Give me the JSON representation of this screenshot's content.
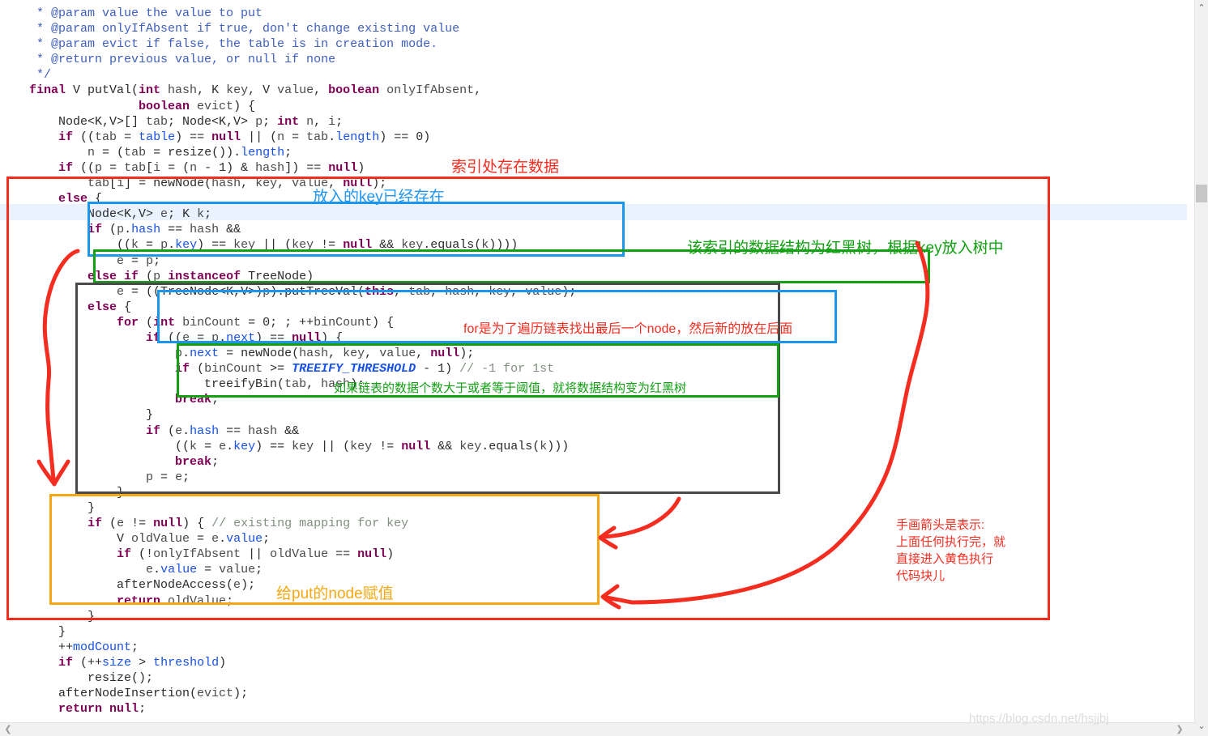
{
  "editor": {
    "language": "java",
    "caret_line_index": 13,
    "code_lines": [
      [
        [
          "doc",
          "     * @param value the value to put"
        ]
      ],
      [
        [
          "doc",
          "     * @param onlyIfAbsent if true, don't change existing value"
        ]
      ],
      [
        [
          "doc",
          "     * @param evict if false, the table is in creation mode."
        ]
      ],
      [
        [
          "doc",
          "     * @return previous value, or null if none"
        ]
      ],
      [
        [
          "doc",
          "     */"
        ]
      ],
      [
        [
          "kw",
          "    final"
        ],
        [
          "pln",
          " V putVal("
        ],
        [
          "kw",
          "int"
        ],
        [
          "idf",
          " hash"
        ],
        [
          "pln",
          ", K "
        ],
        [
          "idf",
          "key"
        ],
        [
          "pln",
          ", V "
        ],
        [
          "idf",
          "value"
        ],
        [
          "pln",
          ", "
        ],
        [
          "kw",
          "boolean"
        ],
        [
          "idf",
          " onlyIfAbsent"
        ],
        [
          "pln",
          ","
        ]
      ],
      [
        [
          "pln",
          "                   "
        ],
        [
          "kw",
          "boolean"
        ],
        [
          "idf",
          " evict"
        ],
        [
          "pln",
          ") {"
        ]
      ],
      [
        [
          "pln",
          "        Node<K,V>[] "
        ],
        [
          "idf",
          "tab"
        ],
        [
          "pln",
          "; Node<K,V> "
        ],
        [
          "idf",
          "p"
        ],
        [
          "pln",
          "; "
        ],
        [
          "kw",
          "int"
        ],
        [
          "idf",
          " n"
        ],
        [
          "pln",
          ", "
        ],
        [
          "idf",
          "i"
        ],
        [
          "pln",
          ";"
        ]
      ],
      [
        [
          "pln",
          "        "
        ],
        [
          "kw",
          "if"
        ],
        [
          "pln",
          " (("
        ],
        [
          "idf",
          "tab"
        ],
        [
          "pln",
          " = "
        ],
        [
          "fld",
          "table"
        ],
        [
          "pln",
          ") == "
        ],
        [
          "kw",
          "null"
        ],
        [
          "pln",
          " || ("
        ],
        [
          "idf",
          "n"
        ],
        [
          "pln",
          " = "
        ],
        [
          "idf",
          "tab"
        ],
        [
          "pln",
          "."
        ],
        [
          "fld",
          "length"
        ],
        [
          "pln",
          ") == 0)"
        ]
      ],
      [
        [
          "pln",
          "            "
        ],
        [
          "idf",
          "n"
        ],
        [
          "pln",
          " = ("
        ],
        [
          "idf",
          "tab"
        ],
        [
          "pln",
          " = resize())."
        ],
        [
          "fld",
          "length"
        ],
        [
          "pln",
          ";"
        ]
      ],
      [
        [
          "pln",
          "        "
        ],
        [
          "kw",
          "if"
        ],
        [
          "pln",
          " (("
        ],
        [
          "idf",
          "p"
        ],
        [
          "pln",
          " = "
        ],
        [
          "idf",
          "tab"
        ],
        [
          "pln",
          "["
        ],
        [
          "idf",
          "i"
        ],
        [
          "pln",
          " = ("
        ],
        [
          "idf",
          "n"
        ],
        [
          "pln",
          " - 1) & "
        ],
        [
          "idf",
          "hash"
        ],
        [
          "pln",
          "]) == "
        ],
        [
          "kw",
          "null"
        ],
        [
          "pln",
          ")"
        ]
      ],
      [
        [
          "pln",
          "            "
        ],
        [
          "idf",
          "tab"
        ],
        [
          "pln",
          "["
        ],
        [
          "idf",
          "i"
        ],
        [
          "pln",
          "] = newNode("
        ],
        [
          "idf",
          "hash"
        ],
        [
          "pln",
          ", "
        ],
        [
          "idf",
          "key"
        ],
        [
          "pln",
          ", "
        ],
        [
          "idf",
          "value"
        ],
        [
          "pln",
          ", "
        ],
        [
          "kw",
          "null"
        ],
        [
          "pln",
          ");"
        ]
      ],
      [
        [
          "pln",
          "        "
        ],
        [
          "kw",
          "else"
        ],
        [
          "pln",
          " {"
        ]
      ],
      [
        [
          "pln",
          "            Node<K,V> "
        ],
        [
          "idf",
          "e"
        ],
        [
          "pln",
          "; K "
        ],
        [
          "idf",
          "k"
        ],
        [
          "pln",
          ";"
        ]
      ],
      [
        [
          "pln",
          "            "
        ],
        [
          "kw",
          "if"
        ],
        [
          "pln",
          " ("
        ],
        [
          "idf",
          "p"
        ],
        [
          "pln",
          "."
        ],
        [
          "fld",
          "hash"
        ],
        [
          "pln",
          " == "
        ],
        [
          "idf",
          "hash"
        ],
        [
          "pln",
          " &&"
        ]
      ],
      [
        [
          "pln",
          "                (("
        ],
        [
          "idf",
          "k"
        ],
        [
          "pln",
          " = "
        ],
        [
          "idf",
          "p"
        ],
        [
          "pln",
          "."
        ],
        [
          "fld",
          "key"
        ],
        [
          "pln",
          ") == "
        ],
        [
          "idf",
          "key"
        ],
        [
          "pln",
          " || ("
        ],
        [
          "idf",
          "key"
        ],
        [
          "pln",
          " != "
        ],
        [
          "kw",
          "null"
        ],
        [
          "pln",
          " && "
        ],
        [
          "idf",
          "key"
        ],
        [
          "pln",
          ".equals("
        ],
        [
          "idf",
          "k"
        ],
        [
          "pln",
          "))))"
        ]
      ],
      [
        [
          "pln",
          "                "
        ],
        [
          "idf",
          "e"
        ],
        [
          "pln",
          " = "
        ],
        [
          "idf",
          "p"
        ],
        [
          "pln",
          ";"
        ]
      ],
      [
        [
          "pln",
          "            "
        ],
        [
          "kw",
          "else if"
        ],
        [
          "pln",
          " ("
        ],
        [
          "idf",
          "p"
        ],
        [
          "pln",
          " "
        ],
        [
          "kw",
          "instanceof"
        ],
        [
          "pln",
          " TreeNode)"
        ]
      ],
      [
        [
          "pln",
          "                "
        ],
        [
          "idf",
          "e"
        ],
        [
          "pln",
          " = ((TreeNode<K,V>)"
        ],
        [
          "idf",
          "p"
        ],
        [
          "pln",
          ").putTreeVal("
        ],
        [
          "kw",
          "this"
        ],
        [
          "pln",
          ", "
        ],
        [
          "idf",
          "tab"
        ],
        [
          "pln",
          ", "
        ],
        [
          "idf",
          "hash"
        ],
        [
          "pln",
          ", "
        ],
        [
          "idf",
          "key"
        ],
        [
          "pln",
          ", "
        ],
        [
          "idf",
          "value"
        ],
        [
          "pln",
          ");"
        ]
      ],
      [
        [
          "pln",
          "            "
        ],
        [
          "kw",
          "else"
        ],
        [
          "pln",
          " {"
        ]
      ],
      [
        [
          "pln",
          "                "
        ],
        [
          "kw",
          "for"
        ],
        [
          "pln",
          " ("
        ],
        [
          "kw",
          "int"
        ],
        [
          "idf",
          " binCount"
        ],
        [
          "pln",
          " = 0; ; ++"
        ],
        [
          "idf",
          "binCount"
        ],
        [
          "pln",
          ") {"
        ]
      ],
      [
        [
          "pln",
          "                    "
        ],
        [
          "kw",
          "if"
        ],
        [
          "pln",
          " (("
        ],
        [
          "idf",
          "e"
        ],
        [
          "pln",
          " = "
        ],
        [
          "idf",
          "p"
        ],
        [
          "pln",
          "."
        ],
        [
          "fld",
          "next"
        ],
        [
          "pln",
          ") == "
        ],
        [
          "kw",
          "null"
        ],
        [
          "pln",
          ") {"
        ]
      ],
      [
        [
          "pln",
          "                        "
        ],
        [
          "idf",
          "p"
        ],
        [
          "pln",
          "."
        ],
        [
          "fld",
          "next"
        ],
        [
          "pln",
          " = newNode("
        ],
        [
          "idf",
          "hash"
        ],
        [
          "pln",
          ", "
        ],
        [
          "idf",
          "key"
        ],
        [
          "pln",
          ", "
        ],
        [
          "idf",
          "value"
        ],
        [
          "pln",
          ", "
        ],
        [
          "kw",
          "null"
        ],
        [
          "pln",
          ");"
        ]
      ],
      [
        [
          "pln",
          "                        "
        ],
        [
          "kw",
          "if"
        ],
        [
          "pln",
          " ("
        ],
        [
          "idf",
          "binCount"
        ],
        [
          "pln",
          " >= "
        ],
        [
          "sfld",
          "TREEIFY_THRESHOLD"
        ],
        [
          "pln",
          " - 1) "
        ],
        [
          "cmt",
          "// -1 for 1st"
        ]
      ],
      [
        [
          "pln",
          "                            treeifyBin("
        ],
        [
          "idf",
          "tab"
        ],
        [
          "pln",
          ", "
        ],
        [
          "idf",
          "hash"
        ],
        [
          "pln",
          ");"
        ]
      ],
      [
        [
          "pln",
          "                        "
        ],
        [
          "kw",
          "break"
        ],
        [
          "pln",
          ";"
        ]
      ],
      [
        [
          "pln",
          "                    }"
        ]
      ],
      [
        [
          "pln",
          "                    "
        ],
        [
          "kw",
          "if"
        ],
        [
          "pln",
          " ("
        ],
        [
          "idf",
          "e"
        ],
        [
          "pln",
          "."
        ],
        [
          "fld",
          "hash"
        ],
        [
          "pln",
          " == "
        ],
        [
          "idf",
          "hash"
        ],
        [
          "pln",
          " &&"
        ]
      ],
      [
        [
          "pln",
          "                        (("
        ],
        [
          "idf",
          "k"
        ],
        [
          "pln",
          " = "
        ],
        [
          "idf",
          "e"
        ],
        [
          "pln",
          "."
        ],
        [
          "fld",
          "key"
        ],
        [
          "pln",
          ") == "
        ],
        [
          "idf",
          "key"
        ],
        [
          "pln",
          " || ("
        ],
        [
          "idf",
          "key"
        ],
        [
          "pln",
          " != "
        ],
        [
          "kw",
          "null"
        ],
        [
          "pln",
          " && "
        ],
        [
          "idf",
          "key"
        ],
        [
          "pln",
          ".equals("
        ],
        [
          "idf",
          "k"
        ],
        [
          "pln",
          ")))"
        ]
      ],
      [
        [
          "pln",
          "                        "
        ],
        [
          "kw",
          "break"
        ],
        [
          "pln",
          ";"
        ]
      ],
      [
        [
          "pln",
          "                    "
        ],
        [
          "idf",
          "p"
        ],
        [
          "pln",
          " = "
        ],
        [
          "idf",
          "e"
        ],
        [
          "pln",
          ";"
        ]
      ],
      [
        [
          "pln",
          "                }"
        ]
      ],
      [
        [
          "pln",
          "            }"
        ]
      ],
      [
        [
          "pln",
          "            "
        ],
        [
          "kw",
          "if"
        ],
        [
          "pln",
          " ("
        ],
        [
          "idf",
          "e"
        ],
        [
          "pln",
          " != "
        ],
        [
          "kw",
          "null"
        ],
        [
          "pln",
          ") { "
        ],
        [
          "cmt",
          "// existing mapping for key"
        ]
      ],
      [
        [
          "pln",
          "                V "
        ],
        [
          "idf",
          "oldValue"
        ],
        [
          "pln",
          " = "
        ],
        [
          "idf",
          "e"
        ],
        [
          "pln",
          "."
        ],
        [
          "fld",
          "value"
        ],
        [
          "pln",
          ";"
        ]
      ],
      [
        [
          "pln",
          "                "
        ],
        [
          "kw",
          "if"
        ],
        [
          "pln",
          " (!"
        ],
        [
          "idf",
          "onlyIfAbsent"
        ],
        [
          "pln",
          " || "
        ],
        [
          "idf",
          "oldValue"
        ],
        [
          "pln",
          " == "
        ],
        [
          "kw",
          "null"
        ],
        [
          "pln",
          ")"
        ]
      ],
      [
        [
          "pln",
          "                    "
        ],
        [
          "idf",
          "e"
        ],
        [
          "pln",
          "."
        ],
        [
          "fld",
          "value"
        ],
        [
          "pln",
          " = "
        ],
        [
          "idf",
          "value"
        ],
        [
          "pln",
          ";"
        ]
      ],
      [
        [
          "pln",
          "                afterNodeAccess("
        ],
        [
          "idf",
          "e"
        ],
        [
          "pln",
          ");"
        ]
      ],
      [
        [
          "pln",
          "                "
        ],
        [
          "kw",
          "return"
        ],
        [
          "idf",
          " oldValue"
        ],
        [
          "pln",
          ";"
        ]
      ],
      [
        [
          "pln",
          "            }"
        ]
      ],
      [
        [
          "pln",
          "        }"
        ]
      ],
      [
        [
          "pln",
          "        ++"
        ],
        [
          "fld",
          "modCount"
        ],
        [
          "pln",
          ";"
        ]
      ],
      [
        [
          "pln",
          "        "
        ],
        [
          "kw",
          "if"
        ],
        [
          "pln",
          " (++"
        ],
        [
          "fld",
          "size"
        ],
        [
          "pln",
          " > "
        ],
        [
          "fld",
          "threshold"
        ],
        [
          "pln",
          ")"
        ]
      ],
      [
        [
          "pln",
          "            resize();"
        ]
      ],
      [
        [
          "pln",
          "        afterNodeInsertion("
        ],
        [
          "idf",
          "evict"
        ],
        [
          "pln",
          ");"
        ]
      ],
      [
        [
          "pln",
          "        "
        ],
        [
          "kw",
          "return"
        ],
        [
          "pln",
          " "
        ],
        [
          "kw",
          "null"
        ],
        [
          "pln",
          ";"
        ]
      ],
      [
        [
          "pln",
          "    }"
        ]
      ]
    ]
  },
  "annotations": {
    "boxes": [
      {
        "id": "box-red",
        "color": "#f42d20",
        "label": "outer-red-else-block"
      },
      {
        "id": "box-blue1",
        "color": "#1c96ea",
        "label": "blue-key-exists-block"
      },
      {
        "id": "box-green1",
        "color": "#12a113",
        "label": "green-treenode-block"
      },
      {
        "id": "box-dark",
        "color": "#4a4a4a",
        "label": "dark-linked-list-block"
      },
      {
        "id": "box-blue2",
        "color": "#1c96ea",
        "label": "blue-for-loop-block"
      },
      {
        "id": "box-green2",
        "color": "#12a113",
        "label": "green-treeify-block"
      },
      {
        "id": "box-yellow",
        "color": "#f5a812",
        "label": "yellow-existing-mapping-block"
      }
    ],
    "labels": {
      "red_index_has_data": "索引处存在数据",
      "blue_key_exists": "放入的key已经存在",
      "green_red_black_tree": "该索引的数据结构为红黑树，根据key放入树中",
      "red_for_loop": "for是为了遍历链表找出最后一个node，然后新的放在后面",
      "green_treeify": "如果链表的数据个数大于或者等于阈值，就将数据结构变为红黑树",
      "yellow_assign_value": "给put的node赋值",
      "red_handdrawn_note_lines": [
        "手画箭头是表示:",
        "上面任何执行完，就",
        "直接进入黄色执行",
        "代码块儿"
      ]
    },
    "ink_color": "#f42d20"
  },
  "scrollbars": {
    "vertical_up_icon": "⌃",
    "vertical_down_icon": "⌄",
    "horizontal_left_icon": "❮",
    "horizontal_right_icon": "❯"
  },
  "watermark": {
    "text": "https://blog.csdn.net/hsjjbj"
  }
}
